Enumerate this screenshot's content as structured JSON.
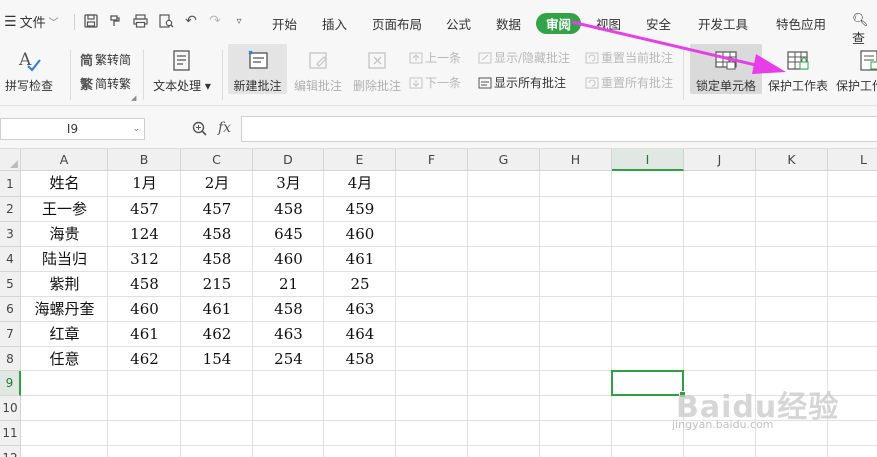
{
  "menubar": {
    "file_label": "文件",
    "tabs": [
      "开始",
      "插入",
      "页面布局",
      "公式",
      "数据",
      "审阅",
      "视图",
      "安全",
      "开发工具",
      "特色应用"
    ],
    "active_tab": "审阅",
    "search_label": "查"
  },
  "toolbar": {
    "spellcheck": "拼写检查",
    "trad_to_simp": "繁转简",
    "simp_to_trad": "简转繁",
    "text_process": "文本处理",
    "new_comment": "新建批注",
    "edit_comment": "编辑批注",
    "delete_comment": "删除批注",
    "prev_comment": "上一条",
    "next_comment": "下一条",
    "show_hide_comment": "显示/隐藏批注",
    "show_all_comments": "显示所有批注",
    "reset_current_comment": "重置当前批注",
    "reset_all_comments": "重置所有批注",
    "lock_cell": "锁定单元格",
    "protect_sheet": "保护工作表",
    "protect_workbook": "保护工作簿"
  },
  "formula_bar": {
    "name_box": "I9",
    "fx": "fx",
    "formula": ""
  },
  "sheet": {
    "columns": [
      "A",
      "B",
      "C",
      "D",
      "E",
      "F",
      "G",
      "H",
      "I",
      "J",
      "K",
      "L"
    ],
    "rows": [
      "1",
      "2",
      "3",
      "4",
      "5",
      "6",
      "7",
      "8",
      "9",
      "10",
      "11",
      "12"
    ],
    "selected_column": "I",
    "selected_row": "9",
    "cells": [
      [
        "姓名",
        "1月",
        "2月",
        "3月",
        "4月"
      ],
      [
        "王一参",
        "457",
        "457",
        "458",
        "459"
      ],
      [
        "海贵",
        "124",
        "458",
        "645",
        "460"
      ],
      [
        "陆当归",
        "312",
        "458",
        "460",
        "461"
      ],
      [
        "紫荆",
        "458",
        "215",
        "21",
        "25"
      ],
      [
        "海螺丹奎",
        "460",
        "461",
        "458",
        "463"
      ],
      [
        "红章",
        "461",
        "462",
        "463",
        "464"
      ],
      [
        "任意",
        "462",
        "154",
        "254",
        "458"
      ]
    ]
  },
  "watermark": {
    "brand": "Baidu经验",
    "url": "jingyan.baidu.com"
  },
  "colors": {
    "accent_green": "#33a34a",
    "arrow_magenta": "#e83ee8"
  }
}
